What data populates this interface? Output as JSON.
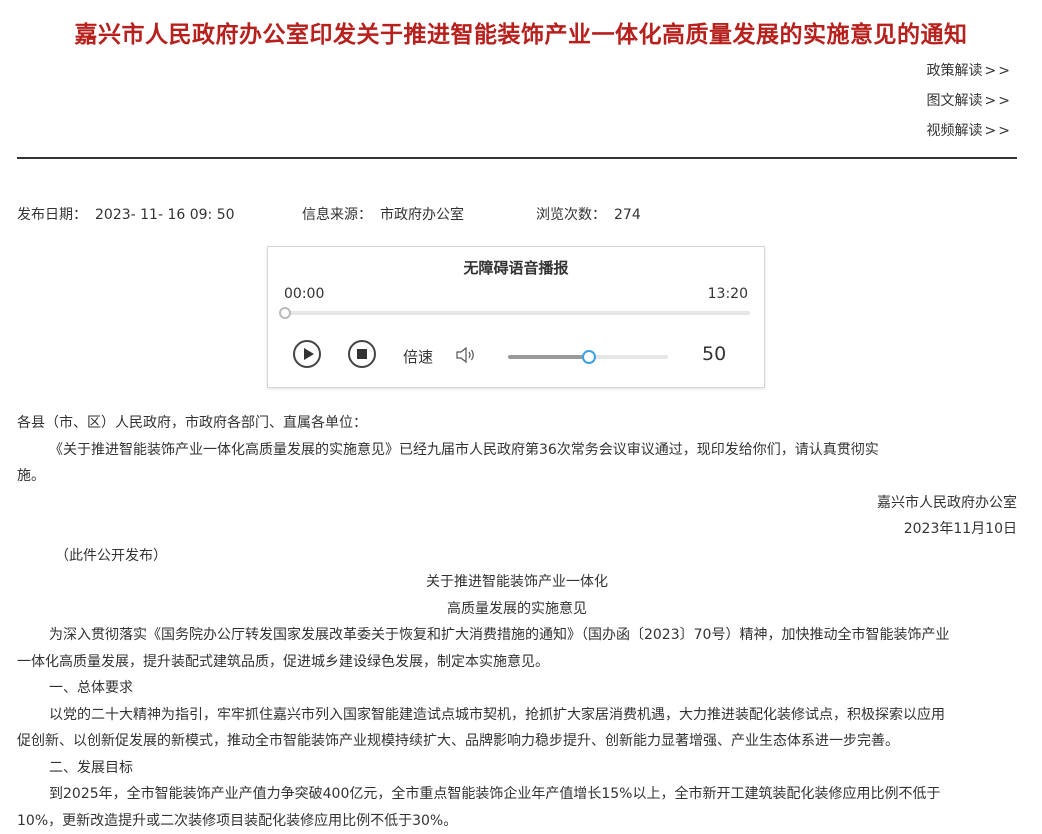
{
  "page": {
    "title": "嘉兴市人民政府办公室印发关于推进智能装饰产业一体化高质量发展的实施意见的通知",
    "links": [
      {
        "label": "政策解读",
        "arrows": ">>"
      },
      {
        "label": "图文解读",
        "arrows": ">>"
      },
      {
        "label": "视频解读",
        "arrows": ">>"
      }
    ]
  },
  "meta": {
    "date_label": "发布日期：",
    "date_value": "2023- 11- 16 09: 50",
    "source_label": "信息来源：",
    "source_value": "市政府办公室",
    "views_label": "浏览次数：",
    "views_value": "274"
  },
  "player": {
    "title": "无障碍语音播报",
    "time_current": "00:00",
    "time_total": "13:20",
    "progress": 0,
    "speed_label": "倍速",
    "volume": 50,
    "volume_value": "50",
    "icons": [
      "play-icon",
      "stop-icon",
      "speaker-icon"
    ]
  },
  "content": {
    "salutation": "各县（市、区）人民政府，市政府各部门、直属各单位：",
    "notice_para_1": "《关于推进智能装饰产业一体化高质量发展的实施意见》已经九届市人民政府第36次常务会议审议通过，现印发给你们，请认真贯彻实",
    "notice_para_2": "施。",
    "issuer": "嘉兴市人民政府办公室",
    "issue_date": "2023年11月10日",
    "public_note": "（此件公开发布）",
    "doc_title_1": "关于推进智能装饰产业一体化",
    "doc_title_2": "高质量发展的实施意见",
    "intro_1": "为深入贯彻落实《国务院办公厅转发国家发展改革委关于恢复和扩大消费措施的通知》（国办函〔2023〕70号）精神，加快推动全市智能装饰产业",
    "intro_2": "一体化高质量发展，提升装配式建筑品质，促进城乡建设绿色发展，制定本实施意见。",
    "section_1": "一、总体要求",
    "section_1_p1": "以党的二十大精神为指引，牢牢抓住嘉兴市列入国家智能建造试点城市契机，抢抓扩大家居消费机遇，大力推进装配化装修试点，积极探索以应用",
    "section_1_p2": "促创新、以创新促发展的新模式，推动全市智能装饰产业规模持续扩大、品牌影响力稳步提升、创新能力显著增强、产业生态体系进一步完善。",
    "section_2": "二、发展目标",
    "section_2_p1": "到2025年，全市智能装饰产业产值力争突破400亿元，全市重点智能装饰企业年产值增长15%以上，全市新开工建筑装配化装修应用比例不低于",
    "section_2_p2": "10%，更新改造提升或二次装修项目装配化装修应用比例不低于30%。"
  }
}
